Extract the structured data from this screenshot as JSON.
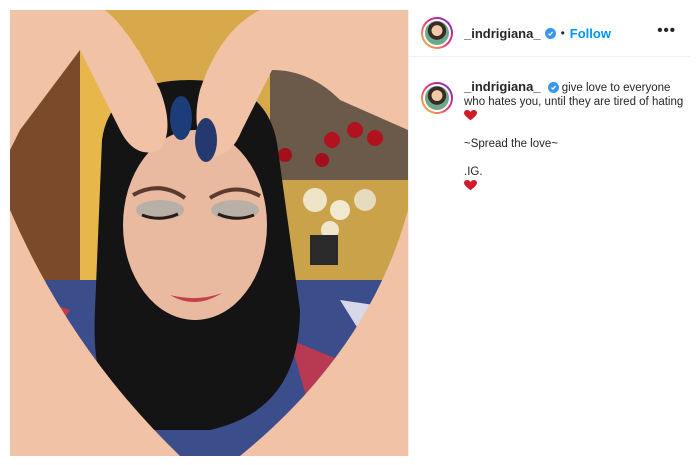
{
  "post": {
    "username": "_indrigiana_",
    "separator": "•",
    "follow_label": "Follow",
    "more_label": "•••",
    "verified_icon": "verified-badge-icon",
    "more_icon": "more-options-icon"
  },
  "caption": {
    "username": "_indrigiana_",
    "line1": "give love to everyone who hates you, until they are tired of hating",
    "line2": "~Spread the love~",
    "line3": ".IG.",
    "heart_icon": "red-heart-emoji",
    "heart_color": "#d11a2a"
  },
  "colors": {
    "follow": "#0095f6",
    "verified": "#3897f0",
    "text": "#262626"
  }
}
